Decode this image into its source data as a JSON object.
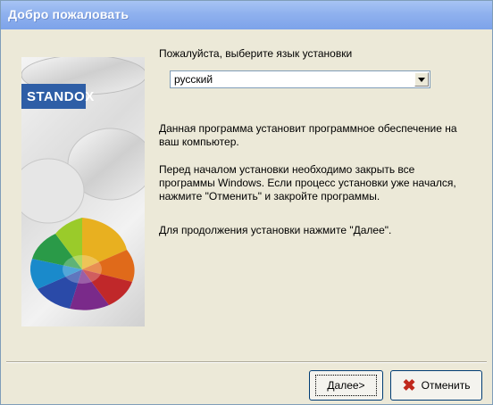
{
  "window": {
    "title": "Добро пожаловать"
  },
  "brand": {
    "logo_text": "STANDOX",
    "colors": {
      "logo_bg": "#2e5ea6",
      "title_bar": "#8fb1ee"
    }
  },
  "language": {
    "label": "Пожалуйста, выберите язык установки",
    "selected": "русский"
  },
  "text": {
    "p1": "Данная программа установит программное обеспечение на\nваш компьютер.",
    "p2": "Перед началом установки необходимо закрыть все\nпрограммы Windows. Если процесс установки уже начался,\nнажмите \"Отменить\" и закройте программы.",
    "p3": "Для продолжения установки нажмите \"Далее\"."
  },
  "buttons": {
    "next": "Далее>",
    "cancel": "Отменить"
  },
  "icons": {
    "cancel": "close-x-icon",
    "dropdown": "chevron-down-icon"
  }
}
